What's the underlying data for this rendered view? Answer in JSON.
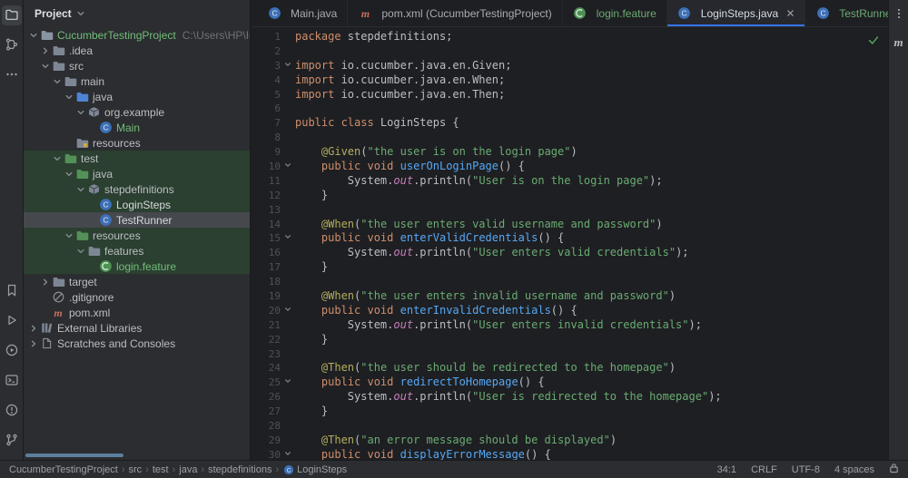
{
  "panel": {
    "title": "Project"
  },
  "activity_bar": {
    "top": [
      {
        "name": "project-folder",
        "active": true
      },
      {
        "name": "structure",
        "active": false
      },
      {
        "name": "more",
        "active": false
      }
    ],
    "bottom": [
      {
        "name": "bookmarks",
        "active": false
      },
      {
        "name": "run",
        "active": false
      },
      {
        "name": "services",
        "active": false
      },
      {
        "name": "terminal",
        "active": false
      },
      {
        "name": "problems",
        "active": false
      },
      {
        "name": "version-control",
        "active": false
      }
    ]
  },
  "tabs": {
    "items": [
      {
        "label": "Main.java",
        "icon": "class",
        "state": "normal",
        "closable": false
      },
      {
        "label": "pom.xml (CucumberTestingProject)",
        "icon": "maven",
        "state": "normal",
        "closable": false
      },
      {
        "label": "login.feature",
        "icon": "cucumber",
        "state": "new",
        "closable": false
      },
      {
        "label": "LoginSteps.java",
        "icon": "class",
        "state": "active",
        "closable": true
      },
      {
        "label": "TestRunner.java",
        "icon": "class",
        "state": "new",
        "closable": false
      }
    ]
  },
  "right_strip": {
    "maven_label": "m"
  },
  "project_tree": {
    "items": [
      {
        "depth": 0,
        "chevron": "down",
        "icon": "project",
        "label": "CucumberTestingProject",
        "extra": "C:\\Users\\HP\\IdeaP",
        "label_class": "green"
      },
      {
        "depth": 1,
        "chevron": "right",
        "icon": "folder",
        "label": ".idea"
      },
      {
        "depth": 1,
        "chevron": "down",
        "icon": "folder",
        "label": "src"
      },
      {
        "depth": 2,
        "chevron": "down",
        "icon": "folder",
        "label": "main"
      },
      {
        "depth": 3,
        "chevron": "down",
        "icon": "folder-blue",
        "label": "java"
      },
      {
        "depth": 4,
        "chevron": "down",
        "icon": "package",
        "label": "org.example"
      },
      {
        "depth": 5,
        "chevron": "none",
        "icon": "class",
        "label": "Main",
        "label_class": "green"
      },
      {
        "depth": 3,
        "chevron": "none",
        "icon": "folder-resources",
        "label": "resources"
      },
      {
        "depth": 2,
        "chevron": "down",
        "icon": "folder-green",
        "label": "test",
        "row": "vcs-new"
      },
      {
        "depth": 3,
        "chevron": "down",
        "icon": "folder-green",
        "label": "java",
        "row": "vcs-new"
      },
      {
        "depth": 4,
        "chevron": "down",
        "icon": "package",
        "label": "stepdefinitions",
        "row": "vcs-new"
      },
      {
        "depth": 5,
        "chevron": "none",
        "icon": "class",
        "label": "LoginSteps",
        "row": "vcs-new",
        "label_class": "white"
      },
      {
        "depth": 5,
        "chevron": "none",
        "icon": "class",
        "label": "TestRunner",
        "row": "selected",
        "label_class": "white"
      },
      {
        "depth": 3,
        "chevron": "down",
        "icon": "folder-green",
        "label": "resources",
        "row": "vcs-new"
      },
      {
        "depth": 4,
        "chevron": "down",
        "icon": "folder",
        "label": "features",
        "row": "vcs-new"
      },
      {
        "depth": 5,
        "chevron": "none",
        "icon": "cucumber",
        "label": "login.feature",
        "row": "vcs-new",
        "label_class": "green"
      },
      {
        "depth": 1,
        "chevron": "right",
        "icon": "folder",
        "label": "target"
      },
      {
        "depth": 1,
        "chevron": "none",
        "icon": "gitignore",
        "label": ".gitignore"
      },
      {
        "depth": 1,
        "chevron": "none",
        "icon": "maven",
        "label": "pom.xml"
      },
      {
        "depth": 0,
        "chevron": "right",
        "icon": "library",
        "label": "External Libraries"
      },
      {
        "depth": 0,
        "chevron": "right",
        "icon": "scratches",
        "label": "Scratches and Consoles"
      }
    ]
  },
  "editor": {
    "lines": [
      {
        "n": 1,
        "fold": false,
        "segs": [
          [
            "k",
            "package"
          ],
          [
            "p",
            " stepdefinitions;"
          ]
        ]
      },
      {
        "n": 2,
        "fold": false,
        "segs": []
      },
      {
        "n": 3,
        "fold": true,
        "segs": [
          [
            "k",
            "import"
          ],
          [
            "p",
            " io.cucumber.java.en.Given;"
          ]
        ]
      },
      {
        "n": 4,
        "fold": false,
        "segs": [
          [
            "k",
            "import"
          ],
          [
            "p",
            " io.cucumber.java.en.When;"
          ]
        ]
      },
      {
        "n": 5,
        "fold": false,
        "segs": [
          [
            "k",
            "import"
          ],
          [
            "p",
            " io.cucumber.java.en.Then;"
          ]
        ]
      },
      {
        "n": 6,
        "fold": false,
        "segs": []
      },
      {
        "n": 7,
        "fold": false,
        "segs": [
          [
            "k",
            "public class"
          ],
          [
            "p",
            " LoginSteps {"
          ]
        ]
      },
      {
        "n": 8,
        "fold": false,
        "segs": []
      },
      {
        "n": 9,
        "fold": false,
        "segs": [
          [
            "p",
            "    "
          ],
          [
            "a",
            "@Given"
          ],
          [
            "p",
            "("
          ],
          [
            "s",
            "\"the user is on the login page\""
          ],
          [
            "p",
            ")"
          ]
        ]
      },
      {
        "n": 10,
        "fold": true,
        "segs": [
          [
            "p",
            "    "
          ],
          [
            "k",
            "public void"
          ],
          [
            "p",
            " "
          ],
          [
            "m",
            "userOnLoginPage"
          ],
          [
            "p",
            "() {"
          ]
        ]
      },
      {
        "n": 11,
        "fold": false,
        "segs": [
          [
            "p",
            "        System."
          ],
          [
            "f",
            "out"
          ],
          [
            "p",
            ".println("
          ],
          [
            "s",
            "\"User is on the login page\""
          ],
          [
            "p",
            ");"
          ]
        ]
      },
      {
        "n": 12,
        "fold": false,
        "segs": [
          [
            "p",
            "    }"
          ]
        ]
      },
      {
        "n": 13,
        "fold": false,
        "segs": []
      },
      {
        "n": 14,
        "fold": false,
        "segs": [
          [
            "p",
            "    "
          ],
          [
            "a",
            "@When"
          ],
          [
            "p",
            "("
          ],
          [
            "s",
            "\"the user enters valid username and password\""
          ],
          [
            "p",
            ")"
          ]
        ]
      },
      {
        "n": 15,
        "fold": true,
        "segs": [
          [
            "p",
            "    "
          ],
          [
            "k",
            "public void"
          ],
          [
            "p",
            " "
          ],
          [
            "m",
            "enterValidCredentials"
          ],
          [
            "p",
            "() {"
          ]
        ]
      },
      {
        "n": 16,
        "fold": false,
        "segs": [
          [
            "p",
            "        System."
          ],
          [
            "f",
            "out"
          ],
          [
            "p",
            ".println("
          ],
          [
            "s",
            "\"User enters valid credentials\""
          ],
          [
            "p",
            ");"
          ]
        ]
      },
      {
        "n": 17,
        "fold": false,
        "segs": [
          [
            "p",
            "    }"
          ]
        ]
      },
      {
        "n": 18,
        "fold": false,
        "segs": []
      },
      {
        "n": 19,
        "fold": false,
        "segs": [
          [
            "p",
            "    "
          ],
          [
            "a",
            "@When"
          ],
          [
            "p",
            "("
          ],
          [
            "s",
            "\"the user enters invalid username and password\""
          ],
          [
            "p",
            ")"
          ]
        ]
      },
      {
        "n": 20,
        "fold": true,
        "segs": [
          [
            "p",
            "    "
          ],
          [
            "k",
            "public void"
          ],
          [
            "p",
            " "
          ],
          [
            "m",
            "enterInvalidCredentials"
          ],
          [
            "p",
            "() {"
          ]
        ]
      },
      {
        "n": 21,
        "fold": false,
        "segs": [
          [
            "p",
            "        System."
          ],
          [
            "f",
            "out"
          ],
          [
            "p",
            ".println("
          ],
          [
            "s",
            "\"User enters invalid credentials\""
          ],
          [
            "p",
            ");"
          ]
        ]
      },
      {
        "n": 22,
        "fold": false,
        "segs": [
          [
            "p",
            "    }"
          ]
        ]
      },
      {
        "n": 23,
        "fold": false,
        "segs": []
      },
      {
        "n": 24,
        "fold": false,
        "segs": [
          [
            "p",
            "    "
          ],
          [
            "a",
            "@Then"
          ],
          [
            "p",
            "("
          ],
          [
            "s",
            "\"the user should be redirected to the homepage\""
          ],
          [
            "p",
            ")"
          ]
        ]
      },
      {
        "n": 25,
        "fold": true,
        "segs": [
          [
            "p",
            "    "
          ],
          [
            "k",
            "public void"
          ],
          [
            "p",
            " "
          ],
          [
            "m",
            "redirectToHomepage"
          ],
          [
            "p",
            "() {"
          ]
        ]
      },
      {
        "n": 26,
        "fold": false,
        "segs": [
          [
            "p",
            "        System."
          ],
          [
            "f",
            "out"
          ],
          [
            "p",
            ".println("
          ],
          [
            "s",
            "\"User is redirected to the homepage\""
          ],
          [
            "p",
            ");"
          ]
        ]
      },
      {
        "n": 27,
        "fold": false,
        "segs": [
          [
            "p",
            "    }"
          ]
        ]
      },
      {
        "n": 28,
        "fold": false,
        "segs": []
      },
      {
        "n": 29,
        "fold": false,
        "segs": [
          [
            "p",
            "    "
          ],
          [
            "a",
            "@Then"
          ],
          [
            "p",
            "("
          ],
          [
            "s",
            "\"an error message should be displayed\""
          ],
          [
            "p",
            ")"
          ]
        ]
      },
      {
        "n": 30,
        "fold": true,
        "segs": [
          [
            "p",
            "    "
          ],
          [
            "k",
            "public void"
          ],
          [
            "p",
            " "
          ],
          [
            "m",
            "displayErrorMessage"
          ],
          [
            "p",
            "() {"
          ]
        ]
      }
    ]
  },
  "status_bar": {
    "breadcrumbs": [
      {
        "label": "CucumberTestingProject"
      },
      {
        "label": "src"
      },
      {
        "label": "test"
      },
      {
        "label": "java"
      },
      {
        "label": "stepdefinitions"
      },
      {
        "label": "LoginSteps",
        "icon": "class"
      }
    ],
    "right_items": [
      {
        "label": "34:1"
      },
      {
        "label": "CRLF"
      },
      {
        "label": "UTF-8"
      },
      {
        "label": "4 spaces"
      }
    ]
  }
}
